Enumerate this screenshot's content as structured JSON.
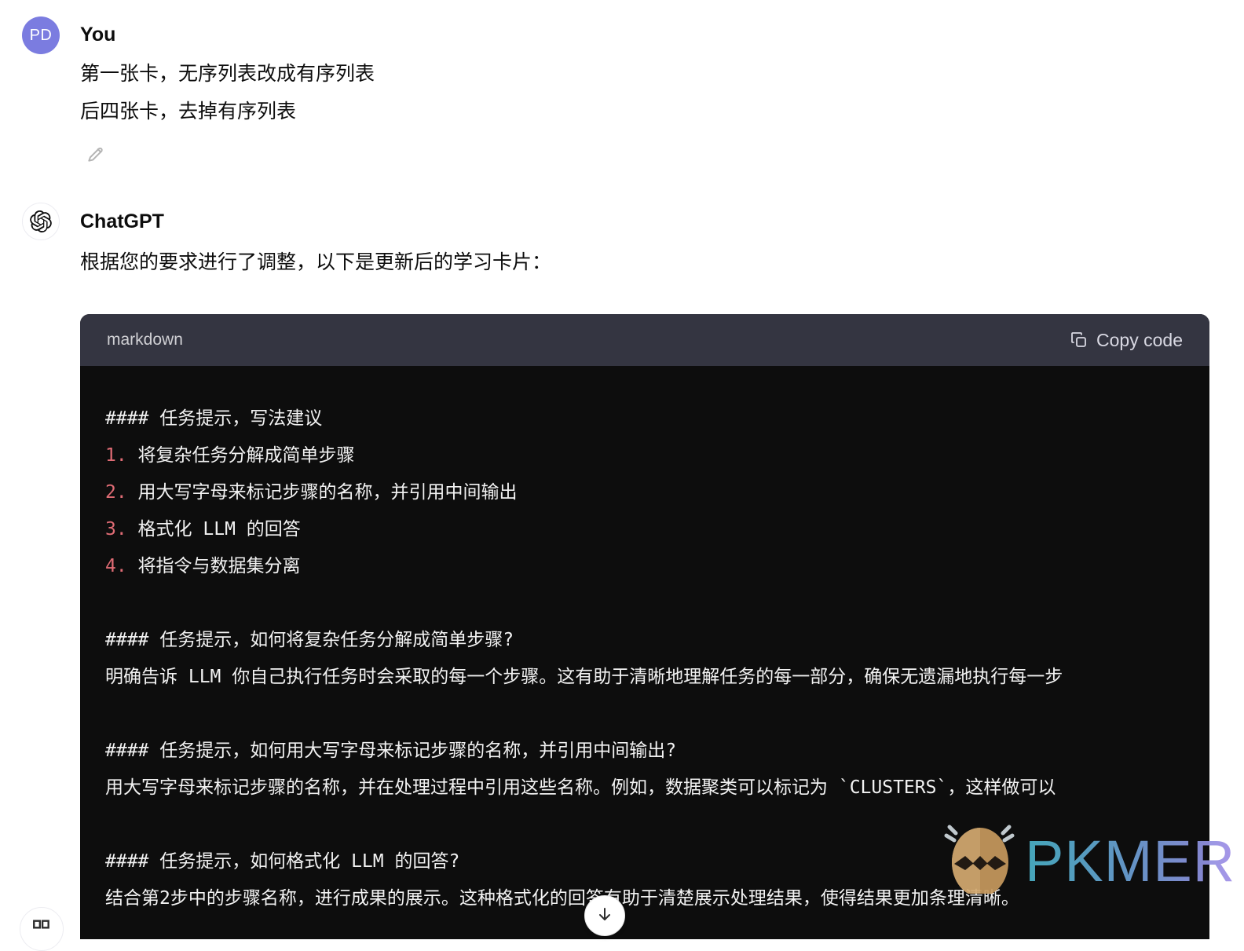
{
  "user_turn": {
    "avatar_initials": "PD",
    "avatar_color": "#7b7ce0",
    "author": "You",
    "message_lines": [
      "第一张卡，无序列表改成有序列表",
      "后四张卡，去掉有序列表"
    ],
    "edit_icon": "pencil-icon"
  },
  "assistant_turn": {
    "avatar_icon": "openai-logo-icon",
    "author": "ChatGPT",
    "intro": "根据您的要求进行了调整，以下是更新后的学习卡片："
  },
  "code_block": {
    "language_label": "markdown",
    "copy_label": "Copy code",
    "copy_icon": "copy-icon",
    "header_bg": "#343541",
    "body_bg": "#0d0d0d",
    "marker_color": "#e06c75",
    "lines": [
      {
        "type": "text",
        "text": "#### 任务提示，写法建议"
      },
      {
        "type": "list",
        "marker": "1.",
        "text": "将复杂任务分解成简单步骤"
      },
      {
        "type": "list",
        "marker": "2.",
        "text": "用大写字母来标记步骤的名称，并引用中间输出"
      },
      {
        "type": "list",
        "marker": "3.",
        "text": "格式化 LLM 的回答"
      },
      {
        "type": "list",
        "marker": "4.",
        "text": "将指令与数据集分离"
      },
      {
        "type": "blank",
        "text": " "
      },
      {
        "type": "text",
        "text": "#### 任务提示，如何将复杂任务分解成简单步骤?"
      },
      {
        "type": "text",
        "text": "明确告诉 LLM 你自己执行任务时会采取的每一个步骤。这有助于清晰地理解任务的每一部分，确保无遗漏地执行每一步"
      },
      {
        "type": "blank",
        "text": " "
      },
      {
        "type": "text",
        "text": "#### 任务提示，如何用大写字母来标记步骤的名称，并引用中间输出?"
      },
      {
        "type": "text",
        "text": "用大写字母来标记步骤的名称，并在处理过程中引用这些名称。例如，数据聚类可以标记为 `CLUSTERS`，这样做可以"
      },
      {
        "type": "blank",
        "text": " "
      },
      {
        "type": "text",
        "text": "#### 任务提示，如何格式化 LLM 的回答?"
      },
      {
        "type": "text",
        "text": "结合第2步中的步骤名称，进行成果的展示。这种格式化的回答有助于清楚展示处理结果，使得结果更加条理清晰。"
      }
    ]
  },
  "watermark": {
    "text": "PKMER",
    "logo_icon": "pkmer-egg-icon",
    "gradient_start": "#4ab3c8",
    "gradient_end": "#9b8ae0"
  },
  "scroll_bottom_button": {
    "icon": "arrow-down-icon"
  },
  "bottom_left_button": {
    "icon": "two-squares-icon"
  }
}
